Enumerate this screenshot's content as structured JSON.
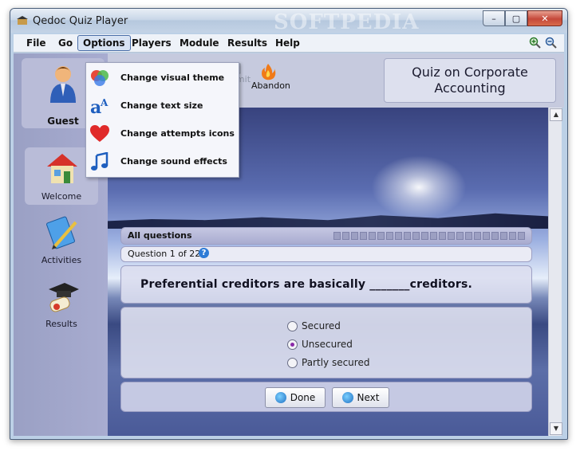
{
  "window": {
    "title": "Qedoc Quiz Player",
    "watermark": "SOFTPEDIA"
  },
  "window_controls": {
    "minimize": "–",
    "maximize": "▢",
    "close": "✕"
  },
  "menu": [
    "File",
    "Go",
    "Options",
    "Players",
    "Module",
    "Results",
    "Help"
  ],
  "options_menu": [
    {
      "label": "Change visual theme",
      "icon": "theme-icon"
    },
    {
      "label": "Change text size",
      "icon": "text-size-icon"
    },
    {
      "label": "Change attempts icons",
      "icon": "heart-icon"
    },
    {
      "label": "Change sound effects",
      "icon": "music-note-icon"
    }
  ],
  "user": {
    "name": "Guest"
  },
  "sidebar": [
    {
      "label": "Welcome",
      "icon": "house-icon",
      "selected": true
    },
    {
      "label": "Activities",
      "icon": "activities-icon",
      "selected": false
    },
    {
      "label": "Results",
      "icon": "graduation-cap-icon",
      "selected": false
    }
  ],
  "toolbar": {
    "submit": "Submit",
    "abandon": "Abandon"
  },
  "quiz_title": {
    "line1": "Quiz on Corporate",
    "line2": "Accounting"
  },
  "quiz": {
    "section": "All questions",
    "question_counter": "Question 1 of 22.",
    "question": "Preferential creditors are basically _______creditors.",
    "options": [
      {
        "label": "Secured",
        "selected": false
      },
      {
        "label": "Unsecured",
        "selected": true
      },
      {
        "label": "Partly secured",
        "selected": false
      }
    ],
    "done_label": "Done",
    "next_label": "Next",
    "progress_total": 22
  },
  "colors": {
    "sidebar": "#a8acd0",
    "accent": "#2e7bd6",
    "close": "#c5483a"
  }
}
